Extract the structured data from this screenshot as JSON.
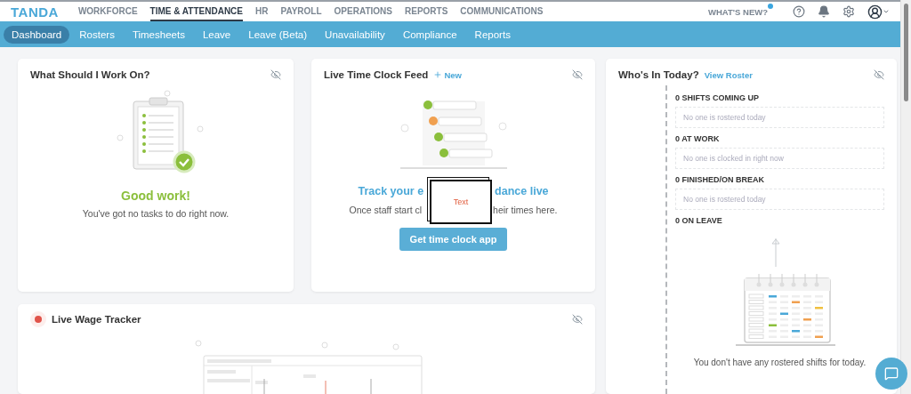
{
  "top_nav": {
    "logo": "TANDA",
    "items": [
      {
        "label": "WORKFORCE",
        "selected": false
      },
      {
        "label": "TIME & ATTENDANCE",
        "selected": true
      },
      {
        "label": "HR",
        "selected": false
      },
      {
        "label": "PAYROLL",
        "selected": false
      },
      {
        "label": "OPERATIONS",
        "selected": false
      },
      {
        "label": "REPORTS",
        "selected": false
      },
      {
        "label": "COMMUNICATIONS",
        "selected": false
      }
    ],
    "whats_new": {
      "label": "WHAT'S NEW?",
      "unread": true
    }
  },
  "sub_nav": {
    "items": [
      {
        "label": "Dashboard",
        "selected": true
      },
      {
        "label": "Rosters",
        "selected": false
      },
      {
        "label": "Timesheets",
        "selected": false
      },
      {
        "label": "Leave",
        "selected": false
      },
      {
        "label": "Leave (Beta)",
        "selected": false
      },
      {
        "label": "Unavailability",
        "selected": false
      },
      {
        "label": "Compliance",
        "selected": false
      },
      {
        "label": "Reports",
        "selected": false
      }
    ]
  },
  "work_card": {
    "title": "What Should I Work On?",
    "heading": "Good work!",
    "message": "You've got no tasks to do right now."
  },
  "clock_card": {
    "title": "Live Time Clock Feed",
    "link": "New",
    "heading_parts": [
      "Track your e",
      "dance live"
    ],
    "message_parts": [
      "Once staff start cl",
      "heir times here."
    ],
    "overlay_note": "Text",
    "button": "Get time clock app"
  },
  "whos_in_card": {
    "title": "Who's In Today?",
    "link": "View Roster",
    "sections": [
      {
        "heading": "0 SHIFTS COMING UP",
        "empty_text": "No one is rostered today"
      },
      {
        "heading": "0 AT WORK",
        "empty_text": "No one is clocked in right now"
      },
      {
        "heading": "0 FINISHED/ON BREAK",
        "empty_text": "No one is rostered today"
      },
      {
        "heading": "0 ON LEAVE"
      }
    ],
    "footer": "You don't have any rostered shifts for today."
  },
  "wage_card": {
    "title": "Live Wage Tracker",
    "live": true
  }
}
